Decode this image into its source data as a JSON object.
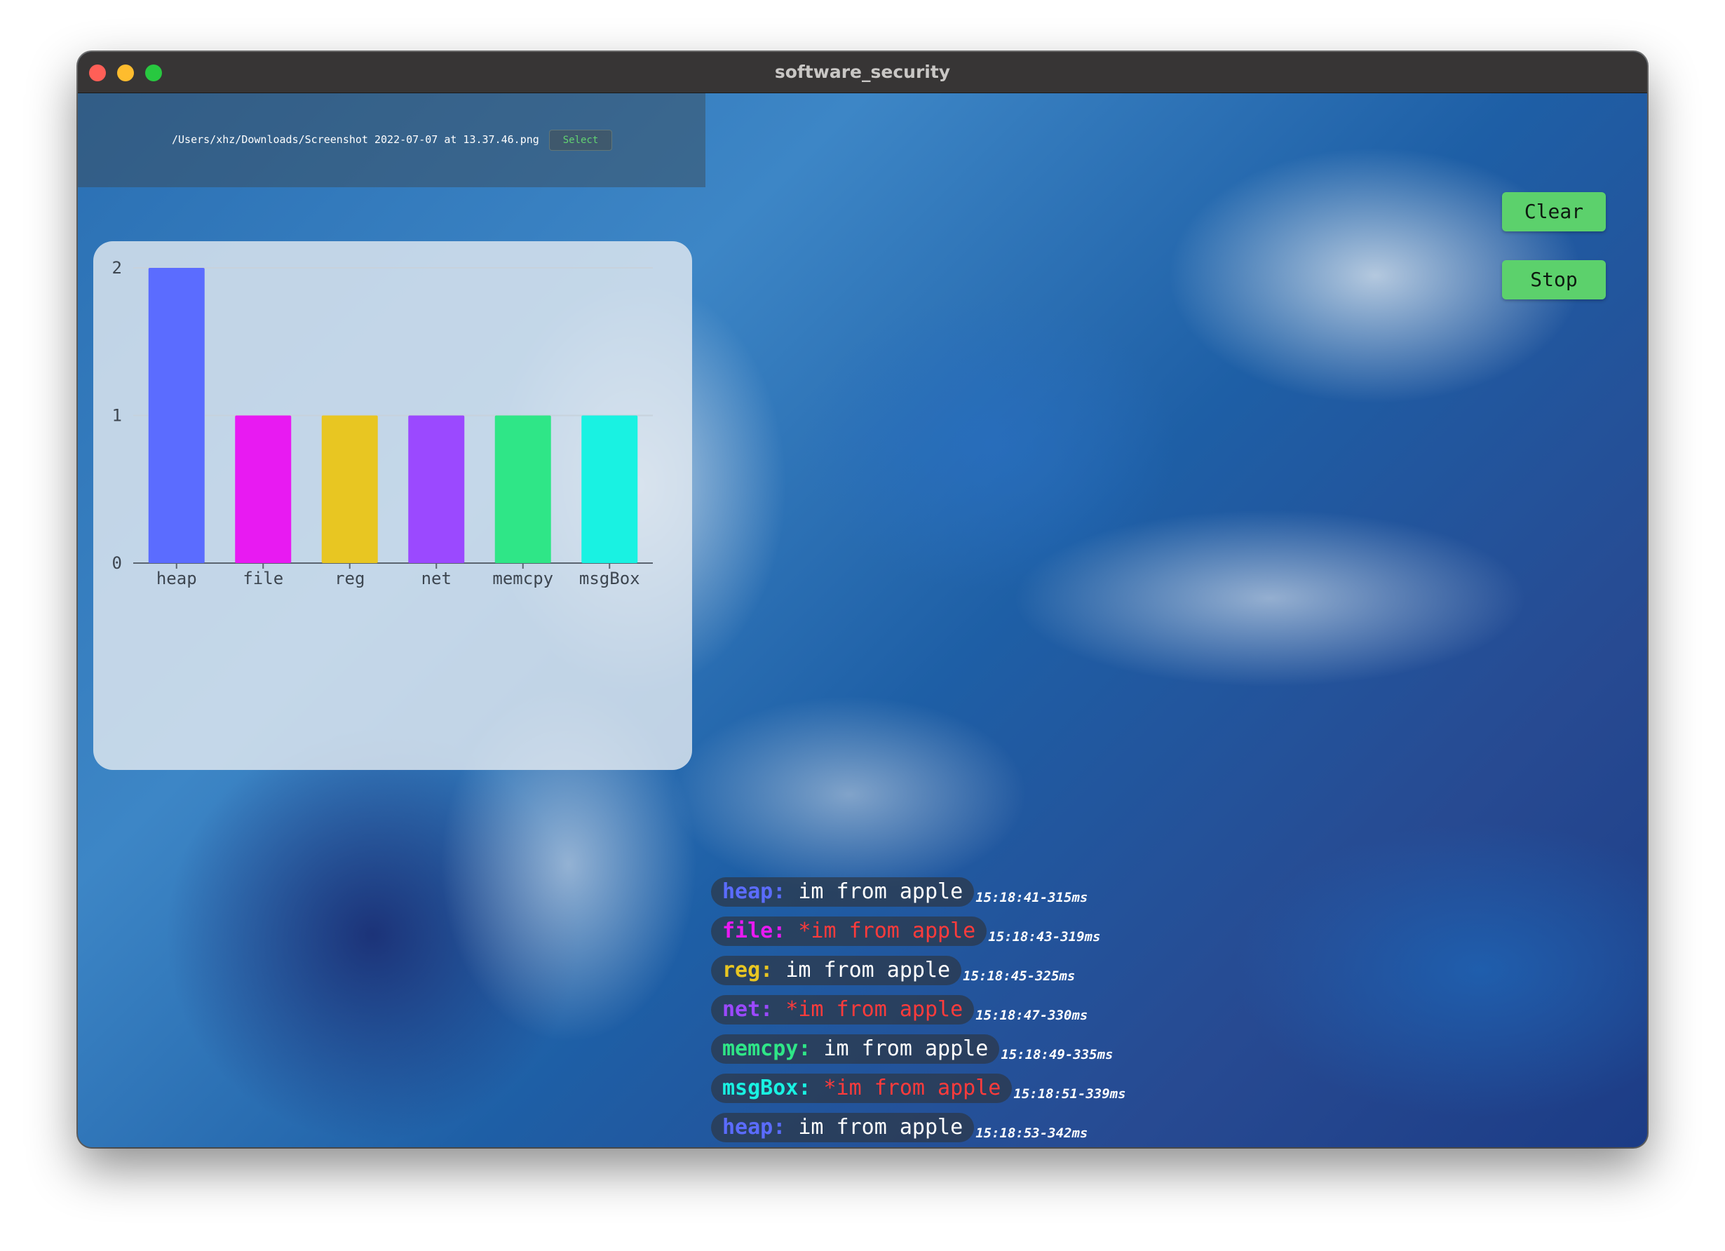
{
  "window": {
    "title": "software_security"
  },
  "file_picker": {
    "path": "/Users/xhz/Downloads/Screenshot 2022-07-07 at 13.37.46.png",
    "select_label": "Select"
  },
  "controls": {
    "clear_label": "Clear",
    "stop_label": "Stop"
  },
  "colors": {
    "heap": "#5b6cff",
    "file": "#e81af2",
    "reg": "#e8c622",
    "net": "#9b49ff",
    "memcpy": "#2fe687",
    "msgBox": "#19f2e2",
    "error_text": "#ff3b3b",
    "button_green": "#5cd16c"
  },
  "chart_data": {
    "type": "bar",
    "categories": [
      "heap",
      "file",
      "reg",
      "net",
      "memcpy",
      "msgBox"
    ],
    "values": [
      2,
      1,
      1,
      1,
      1,
      1
    ],
    "ylim": [
      0,
      2
    ],
    "yticks": [
      0,
      1,
      2
    ],
    "grid": true,
    "title": "",
    "xlabel": "",
    "ylabel": ""
  },
  "logs": [
    {
      "tag": "heap:",
      "message": "im from apple",
      "error": false,
      "time": "15:18:41-315ms",
      "color": "#5b6cff"
    },
    {
      "tag": "file:",
      "message": "*im from apple",
      "error": true,
      "time": "15:18:43-319ms",
      "color": "#e81af2"
    },
    {
      "tag": "reg:",
      "message": "im from apple",
      "error": false,
      "time": "15:18:45-325ms",
      "color": "#e8c622"
    },
    {
      "tag": "net:",
      "message": "*im from apple",
      "error": true,
      "time": "15:18:47-330ms",
      "color": "#9b49ff"
    },
    {
      "tag": "memcpy:",
      "message": "im from apple",
      "error": false,
      "time": "15:18:49-335ms",
      "color": "#2fe687"
    },
    {
      "tag": "msgBox:",
      "message": "*im from apple",
      "error": true,
      "time": "15:18:51-339ms",
      "color": "#19f2e2"
    },
    {
      "tag": "heap:",
      "message": "im from apple",
      "error": false,
      "time": "15:18:53-342ms",
      "color": "#5b6cff"
    }
  ]
}
